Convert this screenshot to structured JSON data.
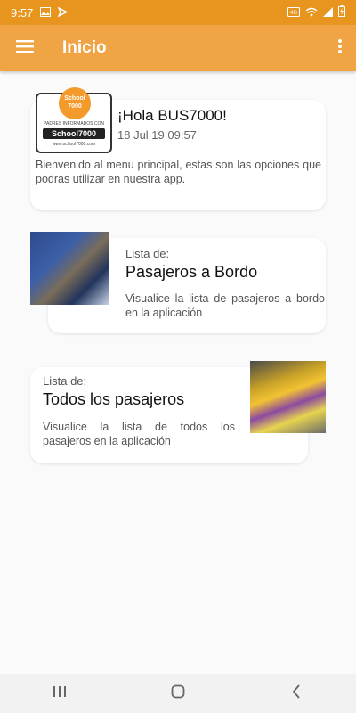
{
  "status_bar": {
    "time": "9:57",
    "left_icons": [
      "image-icon",
      "send-icon"
    ],
    "right_icons": [
      "data-icon",
      "wifi-icon",
      "signal-icon",
      "battery-charging-icon"
    ]
  },
  "app_bar": {
    "title": "Inicio",
    "color": "#f0a444"
  },
  "welcome_card": {
    "logo_badge": "School 7000",
    "logo_tagline": "PADRES INFORMADOS CON",
    "logo_word": "School7000",
    "logo_url": "www.school7000.com",
    "greeting": "¡Hola BUS7000!",
    "date": "18 Jul 19 09:57",
    "description": "Bienvenido al menu principal, estas son las opciones que podras utilizar en nuestra app."
  },
  "option_cards": [
    {
      "label": "Lista de:",
      "title": "Pasajeros a Bordo",
      "description": "Visualice la lista de pasajeros a bordo en la aplicación"
    },
    {
      "label": "Lista de:",
      "title": "Todos los pasajeros",
      "description": "Visualice la lista de todos los pasajeros en la aplicación"
    }
  ],
  "nav_bar": {
    "buttons": [
      "recents-icon",
      "home-icon",
      "back-icon"
    ]
  }
}
